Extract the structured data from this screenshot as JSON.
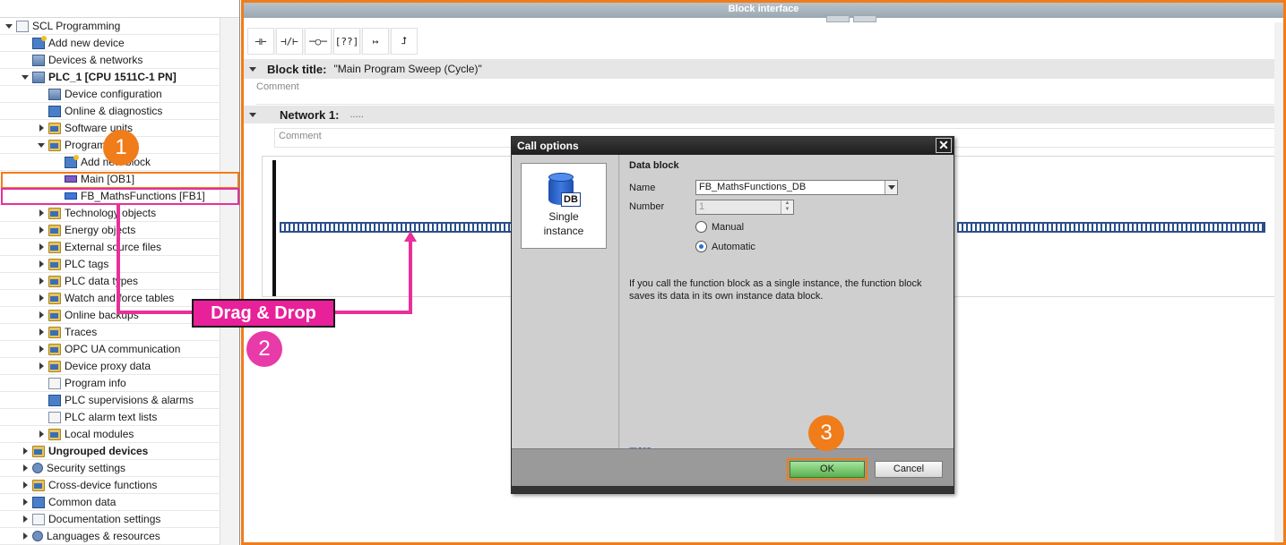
{
  "tree": {
    "items": [
      {
        "label": "SCL Programming",
        "expander": "down",
        "icon": "project-icon",
        "level": 0
      },
      {
        "label": "Add new device",
        "expander": "none",
        "icon": "add-device-icon",
        "level": 1
      },
      {
        "label": "Devices & networks",
        "expander": "none",
        "icon": "network-icon",
        "level": 1
      },
      {
        "label": "PLC_1 [CPU 1511C-1 PN]",
        "expander": "down",
        "icon": "plc-icon",
        "level": 1,
        "bold": true
      },
      {
        "label": "Device configuration",
        "expander": "none",
        "icon": "device-config-icon",
        "level": 2
      },
      {
        "label": "Online & diagnostics",
        "expander": "none",
        "icon": "diagnostics-icon",
        "level": 2
      },
      {
        "label": "Software units",
        "expander": "right",
        "icon": "folder-icon",
        "level": 2
      },
      {
        "label": "Program blocks",
        "expander": "down",
        "icon": "folder-icon",
        "level": 2
      },
      {
        "label": "Add new block",
        "expander": "none",
        "icon": "add-block-icon",
        "level": 3
      },
      {
        "label": "Main [OB1]",
        "expander": "none",
        "icon": "ob-block-icon",
        "level": 3
      },
      {
        "label": "FB_MathsFunctions [FB1]",
        "expander": "none",
        "icon": "fb-block-icon",
        "level": 3
      },
      {
        "label": "Technology objects",
        "expander": "right",
        "icon": "folder-icon",
        "level": 2
      },
      {
        "label": "Energy objects",
        "expander": "right",
        "icon": "folder-icon",
        "level": 2
      },
      {
        "label": "External source files",
        "expander": "right",
        "icon": "folder-icon",
        "level": 2
      },
      {
        "label": "PLC tags",
        "expander": "right",
        "icon": "folder-icon",
        "level": 2
      },
      {
        "label": "PLC data types",
        "expander": "right",
        "icon": "folder-icon",
        "level": 2
      },
      {
        "label": "Watch and force tables",
        "expander": "right",
        "icon": "folder-icon",
        "level": 2
      },
      {
        "label": "Online backups",
        "expander": "right",
        "icon": "folder-icon",
        "level": 2
      },
      {
        "label": "Traces",
        "expander": "right",
        "icon": "folder-icon",
        "level": 2
      },
      {
        "label": "OPC UA communication",
        "expander": "right",
        "icon": "folder-icon",
        "level": 2
      },
      {
        "label": "Device proxy data",
        "expander": "right",
        "icon": "folder-icon",
        "level": 2
      },
      {
        "label": "Program info",
        "expander": "none",
        "icon": "program-info-icon",
        "level": 2
      },
      {
        "label": "PLC supervisions & alarms",
        "expander": "none",
        "icon": "alarms-icon",
        "level": 2
      },
      {
        "label": "PLC alarm text lists",
        "expander": "none",
        "icon": "text-list-icon",
        "level": 2
      },
      {
        "label": "Local modules",
        "expander": "right",
        "icon": "folder-icon",
        "level": 2
      },
      {
        "label": "Ungrouped devices",
        "expander": "right",
        "icon": "folder-icon",
        "level": 1,
        "bold": true
      },
      {
        "label": "Security settings",
        "expander": "right",
        "icon": "security-icon",
        "level": 1
      },
      {
        "label": "Cross-device functions",
        "expander": "right",
        "icon": "folder-icon",
        "level": 1
      },
      {
        "label": "Common data",
        "expander": "right",
        "icon": "common-data-icon",
        "level": 1
      },
      {
        "label": "Documentation settings",
        "expander": "right",
        "icon": "documentation-icon",
        "level": 1
      },
      {
        "label": "Languages & resources",
        "expander": "right",
        "icon": "languages-icon",
        "level": 1
      }
    ]
  },
  "editor": {
    "header": "Block interface",
    "toolbar": [
      {
        "glyph": "⊣⊢",
        "icon": "no-contact-icon"
      },
      {
        "glyph": "⊣/⊢",
        "icon": "nc-contact-icon"
      },
      {
        "glyph": "─○─",
        "icon": "coil-icon"
      },
      {
        "glyph": "[??]",
        "icon": "empty-box-icon"
      },
      {
        "glyph": "↦",
        "icon": "open-branch-icon"
      },
      {
        "glyph": "⮥",
        "icon": "close-branch-icon"
      }
    ],
    "block_title_label": "Block title:",
    "block_title_value": "\"Main Program Sweep (Cycle)\"",
    "comment_placeholder": "Comment",
    "network_label": "Network 1:",
    "network_title": ".....",
    "network_comment_placeholder": "Comment"
  },
  "dialog": {
    "title": "Call options",
    "close_glyph": "✕",
    "instance_card": {
      "line1": "Single",
      "line2": "instance",
      "icon_text": "DB"
    },
    "section_title": "Data block",
    "name_label": "Name",
    "name_value": "FB_MathsFunctions_DB",
    "number_label": "Number",
    "number_value": "1",
    "manual_label": "Manual",
    "automatic_label": "Automatic",
    "selected_option": "automatic",
    "description": "If you call the function block as a single instance, the function block saves its data in its own instance data block.",
    "more_link": "more...",
    "ok_label": "OK",
    "cancel_label": "Cancel"
  },
  "annotations": {
    "step1": "1",
    "step2": "2",
    "step3": "3",
    "drag_label": "Drag & Drop",
    "colors": {
      "orange": "#f07c1a",
      "pink": "#e8309a"
    }
  }
}
